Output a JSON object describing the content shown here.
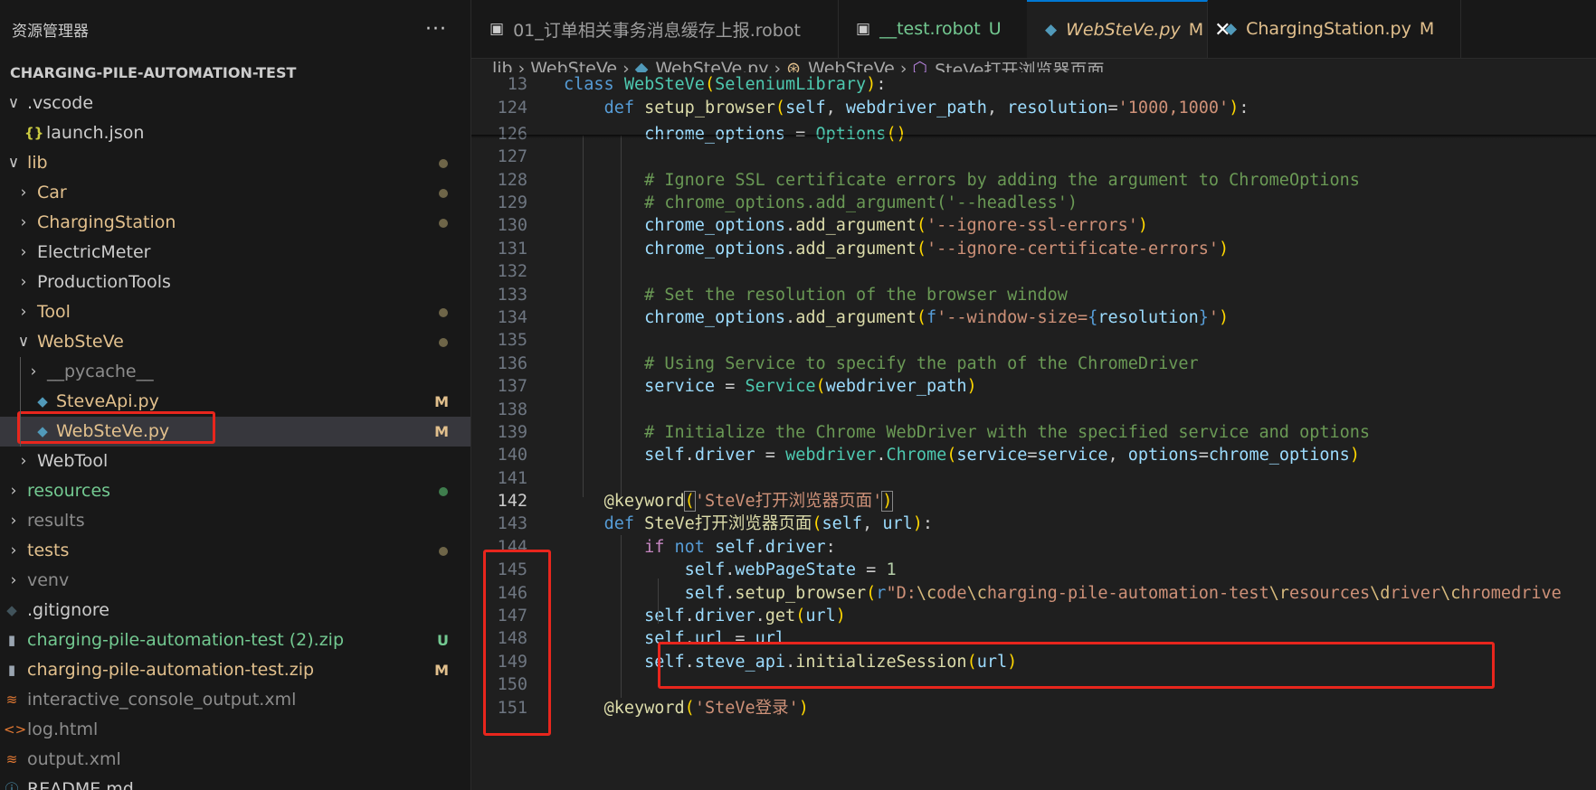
{
  "sidebar": {
    "title": "资源管理器",
    "more": "···",
    "project": "CHARGING-PILE-AUTOMATION-TEST",
    "items": [
      {
        "chev": "∨",
        "icon": "",
        "label": ".vscode",
        "color": "c-white",
        "status": ""
      },
      {
        "chev": "",
        "icon": "{}",
        "label": "launch.json",
        "color": "c-white",
        "status": ""
      },
      {
        "chev": "∨",
        "icon": "",
        "label": "lib",
        "color": "c-yellow",
        "status": "dot"
      },
      {
        "chev": "›",
        "icon": "",
        "label": "Car",
        "color": "c-yellow",
        "status": "dot"
      },
      {
        "chev": "›",
        "icon": "",
        "label": "ChargingStation",
        "color": "c-yellow",
        "status": "dot"
      },
      {
        "chev": "›",
        "icon": "",
        "label": "ElectricMeter",
        "color": "c-white",
        "status": ""
      },
      {
        "chev": "›",
        "icon": "",
        "label": "ProductionTools",
        "color": "c-white",
        "status": ""
      },
      {
        "chev": "›",
        "icon": "",
        "label": "Tool",
        "color": "c-yellow",
        "status": "dot"
      },
      {
        "chev": "∨",
        "icon": "",
        "label": "WebSteVe",
        "color": "c-yellow",
        "status": "dot"
      },
      {
        "chev": "›",
        "icon": "",
        "label": "__pycache__",
        "color": "c-dim",
        "status": ""
      },
      {
        "chev": "",
        "icon": "py",
        "label": "SteveApi.py",
        "color": "c-yellow",
        "status": "M"
      },
      {
        "chev": "",
        "icon": "py",
        "label": "WebSteVe.py",
        "color": "c-yellow",
        "status": "M"
      },
      {
        "chev": "›",
        "icon": "",
        "label": "WebTool",
        "color": "c-white",
        "status": ""
      },
      {
        "chev": "›",
        "icon": "",
        "label": "resources",
        "color": "c-green",
        "status": "dot-green"
      },
      {
        "chev": "›",
        "icon": "",
        "label": "results",
        "color": "c-gray",
        "status": ""
      },
      {
        "chev": "›",
        "icon": "",
        "label": "tests",
        "color": "c-yellow",
        "status": "dot"
      },
      {
        "chev": "›",
        "icon": "",
        "label": "venv",
        "color": "c-gray",
        "status": ""
      },
      {
        "chev": "",
        "icon": "git",
        "label": ".gitignore",
        "color": "c-white",
        "status": ""
      },
      {
        "chev": "",
        "icon": "zip",
        "label": "charging-pile-automation-test (2).zip",
        "color": "c-green",
        "status": "U"
      },
      {
        "chev": "",
        "icon": "zip",
        "label": "charging-pile-automation-test.zip",
        "color": "c-yellow",
        "status": "M"
      },
      {
        "chev": "",
        "icon": "rss",
        "label": "interactive_console_output.xml",
        "color": "c-gray",
        "status": ""
      },
      {
        "chev": "",
        "icon": "html",
        "label": "log.html",
        "color": "c-gray",
        "status": ""
      },
      {
        "chev": "",
        "icon": "rss",
        "label": "output.xml",
        "color": "c-gray",
        "status": ""
      },
      {
        "chev": "",
        "icon": "info",
        "label": "README.md",
        "color": "c-white",
        "status": ""
      }
    ]
  },
  "tabs": [
    {
      "label": "01_订单相关事务消息缓存上报.robot",
      "status": "",
      "icon": "robot"
    },
    {
      "label": "__test.robot",
      "status": "U",
      "icon": "robot"
    },
    {
      "label": "WebSteVe.py",
      "status": "M",
      "icon": "py",
      "active": true
    },
    {
      "label": "ChargingStation.py",
      "status": "M",
      "icon": "py"
    }
  ],
  "breadcrumb": {
    "parts": [
      "lib",
      "WebSteVe",
      "WebSteVe.py",
      "WebSteVe",
      "SteVe打开浏览器页面"
    ]
  },
  "code": {
    "lines": [
      {
        "n": "13",
        "html": "<span class='kw'>class</span> <span class='cls'>WebSteVe</span><span class='br1'>(</span><span class='cls'>SeleniumLibrary</span><span class='br1'>)</span>:"
      },
      {
        "n": "124",
        "html": "    <span class='kw'>def</span> <span class='fn'>setup_browser</span><span class='br1'>(</span><span class='prm'>self</span>, <span class='prm'>webdriver_path</span>, <span class='prm'>resolution</span>=<span class='str'>'1000,1000'</span><span class='br1'>)</span>:"
      },
      {
        "n": "126",
        "html": "        <span class='prm'>chrome_options</span> = <span class='cls'>Options</span><span class='br1'>()</span>"
      },
      {
        "n": "127",
        "html": ""
      },
      {
        "n": "128",
        "html": "        <span class='cmt'># Ignore SSL certificate errors by adding the argument to ChromeOptions</span>"
      },
      {
        "n": "129",
        "html": "        <span class='cmt'># chrome_options.add_argument('--headless')</span>"
      },
      {
        "n": "130",
        "html": "        <span class='prm'>chrome_options</span>.<span class='fn'>add_argument</span><span class='br1'>(</span><span class='str'>'--ignore-ssl-errors'</span><span class='br1'>)</span>"
      },
      {
        "n": "131",
        "html": "        <span class='prm'>chrome_options</span>.<span class='fn'>add_argument</span><span class='br1'>(</span><span class='str'>'--ignore-certificate-errors'</span><span class='br1'>)</span>"
      },
      {
        "n": "132",
        "html": ""
      },
      {
        "n": "133",
        "html": "        <span class='cmt'># Set the resolution of the browser window</span>"
      },
      {
        "n": "134",
        "html": "        <span class='prm'>chrome_options</span>.<span class='fn'>add_argument</span><span class='br1'>(</span><span class='kw'>f</span><span class='str'>'--window-size=</span><span class='kw'>{</span><span class='prm'>resolution</span><span class='kw'>}</span><span class='str'>'</span><span class='br1'>)</span>"
      },
      {
        "n": "135",
        "html": ""
      },
      {
        "n": "136",
        "html": "        <span class='cmt'># Using Service to specify the path of the ChromeDriver</span>"
      },
      {
        "n": "137",
        "html": "        <span class='prm'>service</span> = <span class='cls'>Service</span><span class='br1'>(</span><span class='prm'>webdriver_path</span><span class='br1'>)</span>"
      },
      {
        "n": "138",
        "html": ""
      },
      {
        "n": "139",
        "html": "        <span class='cmt'># Initialize the Chrome WebDriver with the specified service and options</span>"
      },
      {
        "n": "140",
        "html": "        <span class='prm'>self</span>.<span class='prm'>driver</span> = <span class='cls'>webdriver</span>.<span class='cls'>Chrome</span><span class='br1'>(</span><span class='prm'>service</span>=<span class='prm'>service</span>, <span class='prm'>options</span>=<span class='prm'>chrome_options</span><span class='br1'>)</span>"
      },
      {
        "n": "141",
        "html": ""
      },
      {
        "n": "142",
        "html": "    <span class='fn'>@keyword</span><span class='br1' style='outline:1px solid #888'>(</span><span class='str'>'SteVe打开浏览器页面'</span><span class='br1' style='outline:1px solid #888'>)</span>",
        "hot": true
      },
      {
        "n": "143",
        "html": "    <span class='kw'>def</span> <span class='fn'>SteVe打开浏览器页面</span><span class='br1'>(</span><span class='prm'>self</span>, <span class='prm'>url</span><span class='br1'>)</span>:"
      },
      {
        "n": "144",
        "html": "        <span class='kw2'>if</span> <span class='kw'>not</span> <span class='prm'>self</span>.<span class='prm'>driver</span>:"
      },
      {
        "n": "145",
        "html": "            <span class='prm'>self</span>.<span class='prm'>webPageState</span> = <span class='num'>1</span>"
      },
      {
        "n": "146",
        "html": "            <span class='prm'>self</span>.<span class='fn'>setup_browser</span><span class='br1'>(</span><span class='kw'>r</span><span class='str'>\"D:</span><span class='esc'>\\c</span><span class='str'>ode</span><span class='esc'>\\c</span><span class='str'>harging-pile-automation-test</span><span class='esc'>\\r</span><span class='str'>esources</span><span class='esc'>\\d</span><span class='str'>river</span><span class='esc'>\\c</span><span class='str'>hromedrive</span>"
      },
      {
        "n": "147",
        "html": "        <span class='prm'>self</span>.<span class='prm'>driver</span>.<span class='fn'>get</span><span class='br1'>(</span><span class='prm'>url</span><span class='br1'>)</span>"
      },
      {
        "n": "148",
        "html": "        <span class='prm'>self</span>.<span class='prm'>url</span> = <span class='prm'>url</span>"
      },
      {
        "n": "149",
        "html": "        <span class='prm'>self</span>.<span class='prm'>steve_api</span>.<span class='fn'>initializeSession</span><span class='br1'>(</span><span class='prm'>url</span><span class='br1'>)</span>"
      },
      {
        "n": "150",
        "html": ""
      },
      {
        "n": "151",
        "html": "    <span class='fn'>@keyword</span><span class='br1'>(</span><span class='str'>'SteVe登录'</span><span class='br1'>)</span>"
      }
    ]
  }
}
